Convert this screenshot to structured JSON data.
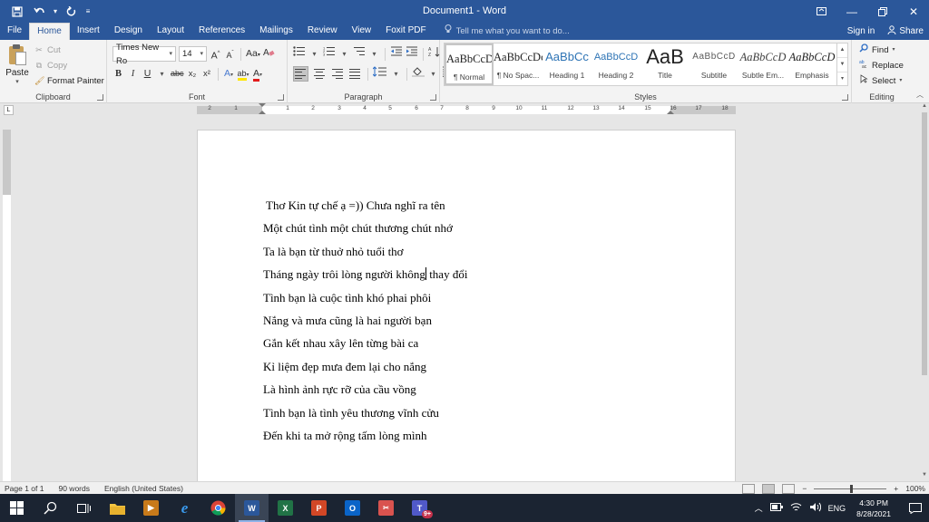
{
  "window": {
    "title": "Document1 - Word",
    "qat": {
      "save_icon": "save-icon",
      "undo_icon": "undo-icon",
      "redo_icon": "redo-icon"
    }
  },
  "tabs": [
    {
      "label": "File"
    },
    {
      "label": "Home"
    },
    {
      "label": "Insert"
    },
    {
      "label": "Design"
    },
    {
      "label": "Layout"
    },
    {
      "label": "References"
    },
    {
      "label": "Mailings"
    },
    {
      "label": "Review"
    },
    {
      "label": "View"
    },
    {
      "label": "Foxit PDF"
    }
  ],
  "tellme": {
    "placeholder": "Tell me what you want to do..."
  },
  "account": {
    "signin": "Sign in",
    "share": "Share"
  },
  "clipboard": {
    "paste": "Paste",
    "cut": "Cut",
    "copy": "Copy",
    "format_painter": "Format Painter",
    "label": "Clipboard"
  },
  "font": {
    "name": "Times New Ro",
    "size": "14",
    "grow": "A",
    "shrink": "A",
    "case": "Aa",
    "bold": "B",
    "italic": "I",
    "underline": "U",
    "strike": "abc",
    "subscript": "x₂",
    "superscript": "x²",
    "effects": "A",
    "highlight": "ab",
    "color": "A",
    "label": "Font"
  },
  "paragraph": {
    "label": "Paragraph",
    "pilcrow": "¶"
  },
  "styles": {
    "items": [
      {
        "sample": "AaBbCcDc",
        "name": "¶ Normal"
      },
      {
        "sample": "AaBbCcDc",
        "name": "¶ No Spac..."
      },
      {
        "sample": "AaBbCc",
        "name": "Heading 1"
      },
      {
        "sample": "AaBbCcD",
        "name": "Heading 2"
      },
      {
        "sample": "AaB",
        "name": "Title"
      },
      {
        "sample": "AaBbCcD",
        "name": "Subtitle"
      },
      {
        "sample": "AaBbCcD",
        "name": "Subtle Em..."
      },
      {
        "sample": "AaBbCcD",
        "name": "Emphasis"
      }
    ],
    "label": "Styles"
  },
  "editing": {
    "find": "Find",
    "replace": "Replace",
    "select": "Select",
    "label": "Editing"
  },
  "ruler": {
    "numbers_left": [
      "2",
      "1"
    ],
    "numbers_right": [
      "1",
      "2",
      "3",
      "4",
      "5",
      "6",
      "7",
      "8",
      "9",
      "10",
      "11",
      "12",
      "13",
      "14",
      "15",
      "16",
      "17",
      "18"
    ]
  },
  "document": {
    "lines": [
      " Thơ Kin tự chế ạ =)) Chưa nghĩ ra tên",
      "Một chút tình một chút thương chút nhớ",
      "Ta là bạn từ thuở nhỏ tuổi thơ",
      "Tháng ngày trôi lòng người không",
      "Tình bạn là cuộc tình khó phai phôi",
      "Nắng và mưa cũng là hai người bạn",
      "Gắn kết nhau xây lên từng bài ca",
      "Kỉ liệm đẹp mưa đem lại cho nắng",
      "Là hình ảnh rực rỡ của cầu vồng",
      "Tình bạn là tình yêu thương vĩnh cửu",
      "Đến khi ta mở rộng tấm lòng mình"
    ],
    "line4_after_caret": " thay đổi"
  },
  "status": {
    "page": "Page 1 of 1",
    "words": "90 words",
    "language": "English (United States)",
    "zoom": "100%"
  },
  "taskbar": {
    "time": "4:30 PM",
    "date": "8/28/2021",
    "lang": "ENG",
    "teams_badge": "9+"
  },
  "colors": {
    "word_blue": "#2b579a",
    "ribbon_bg": "#f3f3f3",
    "taskbar_bg": "#1b2432"
  }
}
